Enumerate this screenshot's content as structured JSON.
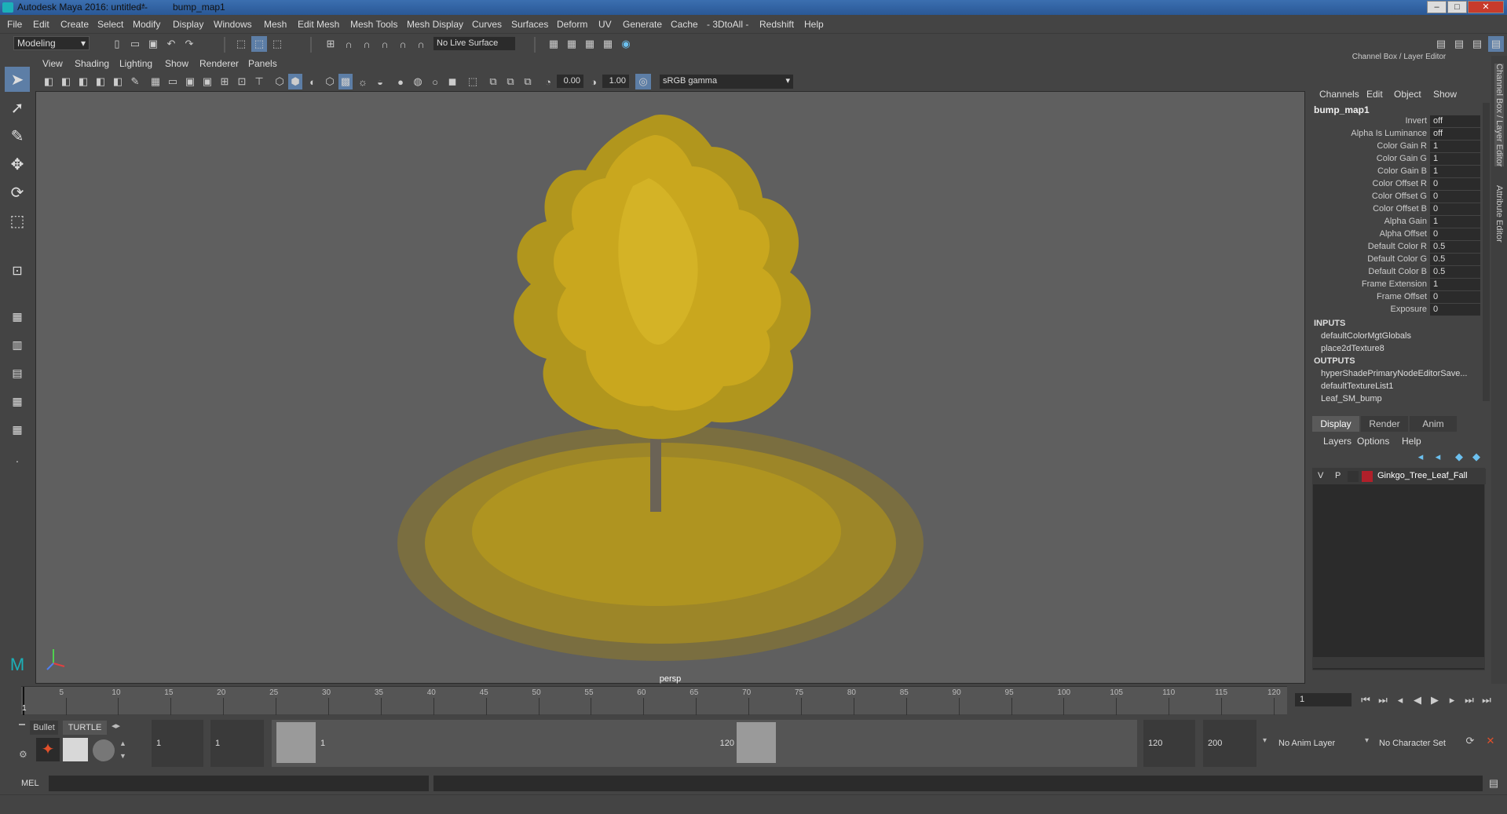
{
  "titlebar": {
    "title": "Autodesk Maya 2016: untitled*   ---   bump_map1",
    "app": "Autodesk Maya 2016: untitled*",
    "node": "bump_map1",
    "separator": "---"
  },
  "menubar": [
    "File",
    "Edit",
    "Create",
    "Select",
    "Modify",
    "Display",
    "Windows",
    "Mesh",
    "Edit Mesh",
    "Mesh Tools",
    "Mesh Display",
    "Curves",
    "Surfaces",
    "Deform",
    "UV",
    "Generate",
    "Cache",
    "- 3DtoAll -",
    "Redshift",
    "Help"
  ],
  "statusline": {
    "mode": "Modeling",
    "live_surface": "No Live Surface"
  },
  "viewport": {
    "menus": [
      "View",
      "Shading",
      "Lighting",
      "Show",
      "Renderer",
      "Panels"
    ],
    "exposure": "0.00",
    "gamma": "1.00",
    "colorspace": "sRGB gamma",
    "camera_label": "persp"
  },
  "channelbox": {
    "title": "Channel Box / Layer Editor",
    "menus": [
      "Channels",
      "Edit",
      "Object",
      "Show"
    ],
    "node": "bump_map1",
    "attrs": [
      {
        "name": "Invert",
        "value": "off"
      },
      {
        "name": "Alpha Is Luminance",
        "value": "off"
      },
      {
        "name": "Color Gain R",
        "value": "1"
      },
      {
        "name": "Color Gain G",
        "value": "1"
      },
      {
        "name": "Color Gain B",
        "value": "1"
      },
      {
        "name": "Color Offset R",
        "value": "0"
      },
      {
        "name": "Color Offset G",
        "value": "0"
      },
      {
        "name": "Color Offset B",
        "value": "0"
      },
      {
        "name": "Alpha Gain",
        "value": "1"
      },
      {
        "name": "Alpha Offset",
        "value": "0"
      },
      {
        "name": "Default Color R",
        "value": "0.5"
      },
      {
        "name": "Default Color G",
        "value": "0.5"
      },
      {
        "name": "Default Color B",
        "value": "0.5"
      },
      {
        "name": "Frame Extension",
        "value": "1"
      },
      {
        "name": "Frame Offset",
        "value": "0"
      },
      {
        "name": "Exposure",
        "value": "0"
      }
    ],
    "inputs_label": "INPUTS",
    "inputs": [
      "defaultColorMgtGlobals",
      "place2dTexture8"
    ],
    "outputs_label": "OUTPUTS",
    "outputs": [
      "hyperShadePrimaryNodeEditorSave...",
      "defaultTextureList1",
      "Leaf_SM_bump"
    ]
  },
  "layereditor": {
    "tabs": [
      "Display",
      "Render",
      "Anim"
    ],
    "menus": [
      "Layers",
      "Options",
      "Help"
    ],
    "layer": {
      "v": "V",
      "p": "P",
      "name": "Ginkgo_Tree_Leaf_Fall",
      "color": "#b0202a"
    }
  },
  "sidetabs": [
    "Channel Box / Layer Editor",
    "Attribute Editor"
  ],
  "timeslider": {
    "ticks": [
      "5",
      "10",
      "15",
      "20",
      "25",
      "30",
      "35",
      "40",
      "45",
      "50",
      "55",
      "60",
      "65",
      "70",
      "75",
      "80",
      "85",
      "90",
      "95",
      "100",
      "105",
      "110",
      "115",
      "120"
    ],
    "start_tick": "1",
    "current_frame": "1"
  },
  "range": {
    "shelf_tabs": [
      "Bullet",
      "TURTLE"
    ],
    "start": "1",
    "start2": "1",
    "range_start": "1",
    "range_end": "120",
    "end": "120",
    "max": "200",
    "anim_layer": "No Anim Layer",
    "char_set": "No Character Set"
  },
  "cmdline": {
    "label": "MEL"
  },
  "colors": {
    "foliage": "#c9a71e",
    "ground": "#b3961e",
    "viewport_bg": "#5f5f5f"
  }
}
